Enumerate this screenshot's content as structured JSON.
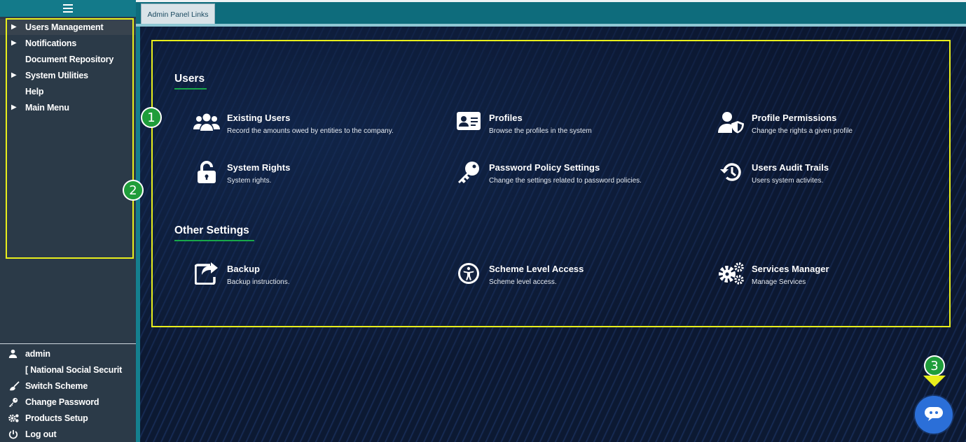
{
  "sidebar": {
    "menu": [
      {
        "label": "Users Management",
        "expandable": true,
        "active": true
      },
      {
        "label": "Notifications",
        "expandable": true,
        "active": false
      },
      {
        "label": "Document Repository",
        "expandable": false,
        "active": false
      },
      {
        "label": "System Utilities",
        "expandable": true,
        "active": false
      },
      {
        "label": "Help",
        "expandable": false,
        "active": false
      },
      {
        "label": "Main Menu",
        "expandable": true,
        "active": false
      }
    ],
    "user": {
      "name": "admin",
      "scheme": "[ National Social Securit",
      "switch_scheme": "Switch Scheme",
      "change_password": "Change Password",
      "products_setup": "Products Setup",
      "logout": "Log out"
    }
  },
  "tabs": [
    {
      "label": "Admin Panel Links"
    }
  ],
  "sections": {
    "users": {
      "title": "Users",
      "cards": [
        {
          "title": "Existing Users",
          "desc": "Record the amounts owed by entities to the company.",
          "icon": "users-group-icon"
        },
        {
          "title": "Profiles",
          "desc": "Browse the profiles in the system",
          "icon": "id-card-icon"
        },
        {
          "title": "Profile Permissions",
          "desc": "Change the rights a given profile",
          "icon": "user-shield-icon"
        },
        {
          "title": "System Rights",
          "desc": "System rights.",
          "icon": "unlock-icon"
        },
        {
          "title": "Password Policy Settings",
          "desc": "Change the settings related to password policies.",
          "icon": "key-icon"
        },
        {
          "title": "Users Audit Trails",
          "desc": "Users system activites.",
          "icon": "history-icon"
        }
      ]
    },
    "other": {
      "title": "Other Settings",
      "cards": [
        {
          "title": "Backup",
          "desc": "Backup instructions.",
          "icon": "share-square-icon"
        },
        {
          "title": "Scheme Level Access",
          "desc": "Scheme level access.",
          "icon": "accessibility-icon"
        },
        {
          "title": "Services Manager",
          "desc": "Manage Services",
          "icon": "cogs-icon"
        }
      ]
    }
  },
  "annotations": {
    "marker_1": "1",
    "marker_2": "2",
    "marker_3": "3"
  },
  "colors": {
    "highlight": "#e8ee1c",
    "marker": "#1f9d3a",
    "topbar": "#0e6c7c",
    "chat_button": "#2b6fd8"
  }
}
